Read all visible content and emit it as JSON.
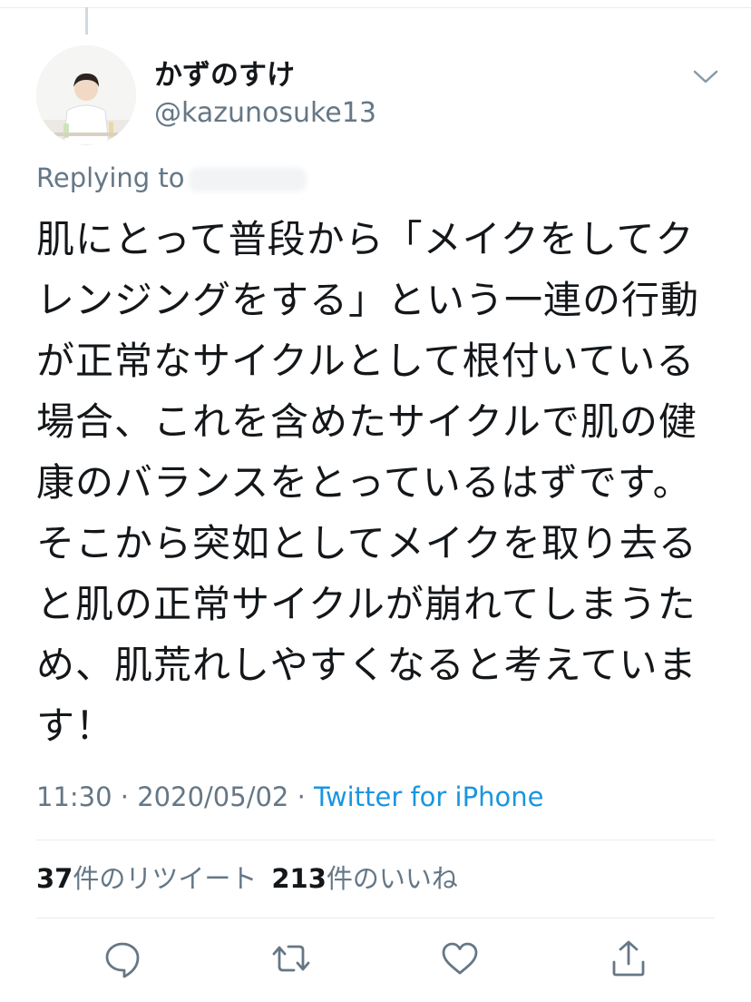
{
  "tweet": {
    "author": {
      "display_name": "かずのすけ",
      "handle": "@kazunosuke13"
    },
    "replying_to": "Replying to",
    "text_lines": [
      "肌にとって普段から「メイクをしてク",
      "レンジングをする」という一連の行動",
      "が正常なサイクルとして根付いている",
      "場合、これを含めたサイクルで肌の健",
      "康のバランスをとっているはずです。",
      "そこから突如としてメイクを取り去る",
      "と肌の正常サイクルが崩れてしまうた",
      "め、肌荒れしやすくなると考えていま",
      "す！"
    ],
    "time": "11:30",
    "date": "2020/05/02",
    "separator": " · ",
    "source": "Twitter for iPhone"
  },
  "stats": {
    "retweet_count": "37",
    "retweet_label": "件のリツイート",
    "like_count": "213",
    "like_label": "件のいいね"
  },
  "actions": {
    "reply_icon": "reply-icon",
    "retweet_icon": "retweet-icon",
    "like_icon": "heart-icon",
    "share_icon": "share-icon"
  },
  "colors": {
    "text": "#14171a",
    "secondary": "#657786",
    "link": "#1b95e0",
    "divider": "#e6ecf0"
  }
}
